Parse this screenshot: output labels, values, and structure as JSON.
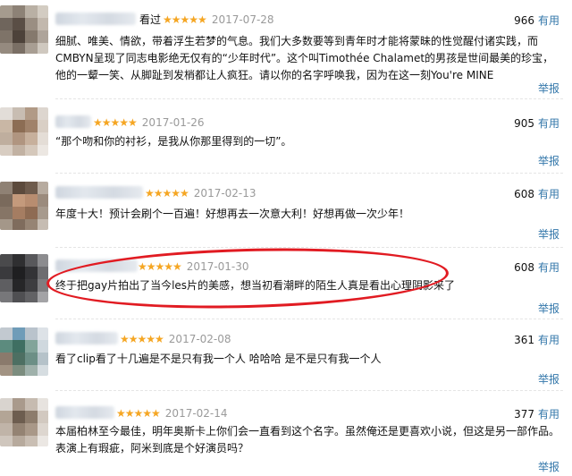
{
  "comments": [
    {
      "watched": "看过",
      "stars": "★★★★★",
      "date": "2017-07-28",
      "votes": "966",
      "useful": "有用",
      "text": "细腻、唯美、情欲，带着浮生若梦的气息。我们大多数要等到青年时才能将蒙昧的性觉醒付诸实践，而CMBYN呈现了同志电影绝无仅有的“少年时代”。这个叫Timothée Chalamet的男孩是世间最美的珍宝，他的一颦一笑、从脚趾到发梢都让人疯狂。请以你的名字呼唤我，因为在这一刻You're MINE",
      "report": "举报"
    },
    {
      "watched": "",
      "stars": "★★★★★",
      "date": "2017-01-26",
      "votes": "905",
      "useful": "有用",
      "text": "“那个吻和你的衬衫，是我从你那里得到的一切”。",
      "report": "举报"
    },
    {
      "watched": "",
      "stars": "★★★★★",
      "date": "2017-02-13",
      "votes": "608",
      "useful": "有用",
      "text": "年度十大！预计会刷个一百遍！好想再去一次意大利！好想再做一次少年！",
      "report": "举报"
    },
    {
      "watched": "",
      "stars": "★★★★★",
      "date": "2017-01-30",
      "votes": "608",
      "useful": "有用",
      "text": "终于把gay片拍出了当今les片的美感，想当初看潮畔的陌生人真是看出心理阴影来了",
      "report": "举报"
    },
    {
      "watched": "",
      "stars": "★★★★★",
      "date": "2017-02-08",
      "votes": "361",
      "useful": "有用",
      "text": "看了clip看了十几遍是不是只有我一个人 哈哈哈 是不是只有我一个人",
      "report": "举报"
    },
    {
      "watched": "",
      "stars": "★★★★★",
      "date": "2017-02-14",
      "votes": "377",
      "useful": "有用",
      "text": "本届柏林至今最佳，明年奥斯卡上你们会一直看到这个名字。虽然俺还是更喜欢小说，但这是另一部作品。表演上有瑕疵，阿米到底是个好演员吗？",
      "report": "举报"
    }
  ],
  "colors": {
    "star": "#f5a623",
    "link": "#3377aa",
    "highlight_ellipse": "#e11b22"
  }
}
